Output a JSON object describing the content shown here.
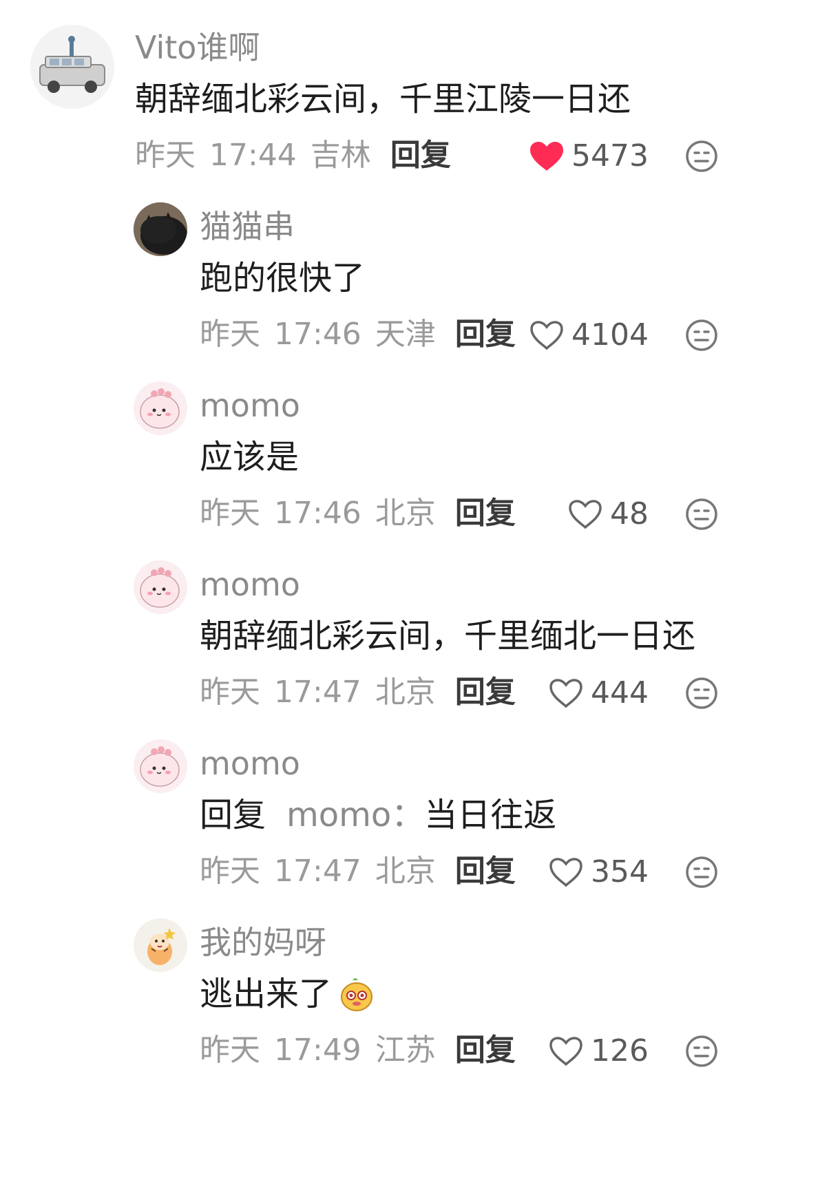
{
  "comments": [
    {
      "username": "Vito谁啊",
      "text": "朝辞缅北彩云间，千里江陵一日还",
      "date": "昨天",
      "time": "17:44",
      "location": "吉林",
      "reply_label": "回复",
      "likes": "5473",
      "liked": true,
      "avatar_icon": "suv-car-avatar"
    },
    {
      "username": "猫猫串",
      "text": "跑的很快了",
      "date": "昨天",
      "time": "17:46",
      "location": "天津",
      "reply_label": "回复",
      "likes": "4104",
      "liked": false,
      "avatar_icon": "black-cat-avatar"
    },
    {
      "username": "momo",
      "text": "应该是",
      "date": "昨天",
      "time": "17:46",
      "location": "北京",
      "reply_label": "回复",
      "likes": "48",
      "liked": false,
      "avatar_icon": "pink-cartoon-avatar"
    },
    {
      "username": "momo",
      "text": "朝辞缅北彩云间，千里缅北一日还",
      "date": "昨天",
      "time": "17:47",
      "location": "北京",
      "reply_label": "回复",
      "likes": "444",
      "liked": false,
      "avatar_icon": "pink-cartoon-avatar"
    },
    {
      "username": "momo",
      "text_reply_prefix": "回复",
      "text_reply_target": "momo：",
      "text": "当日往返",
      "date": "昨天",
      "time": "17:47",
      "location": "北京",
      "reply_label": "回复",
      "likes": "354",
      "liked": false,
      "avatar_icon": "pink-cartoon-avatar"
    },
    {
      "username": "我的妈呀",
      "text": "逃出来了",
      "text_emoji": "sticker-emoji",
      "date": "昨天",
      "time": "17:49",
      "location": "江苏",
      "reply_label": "回复",
      "likes": "126",
      "liked": false,
      "avatar_icon": "cartoon-tiger-avatar"
    }
  ],
  "colors": {
    "username": "#8a8a8a",
    "meta": "#9a9a9a",
    "like_active": "#fe2c55",
    "text": "#1e1e1e"
  }
}
